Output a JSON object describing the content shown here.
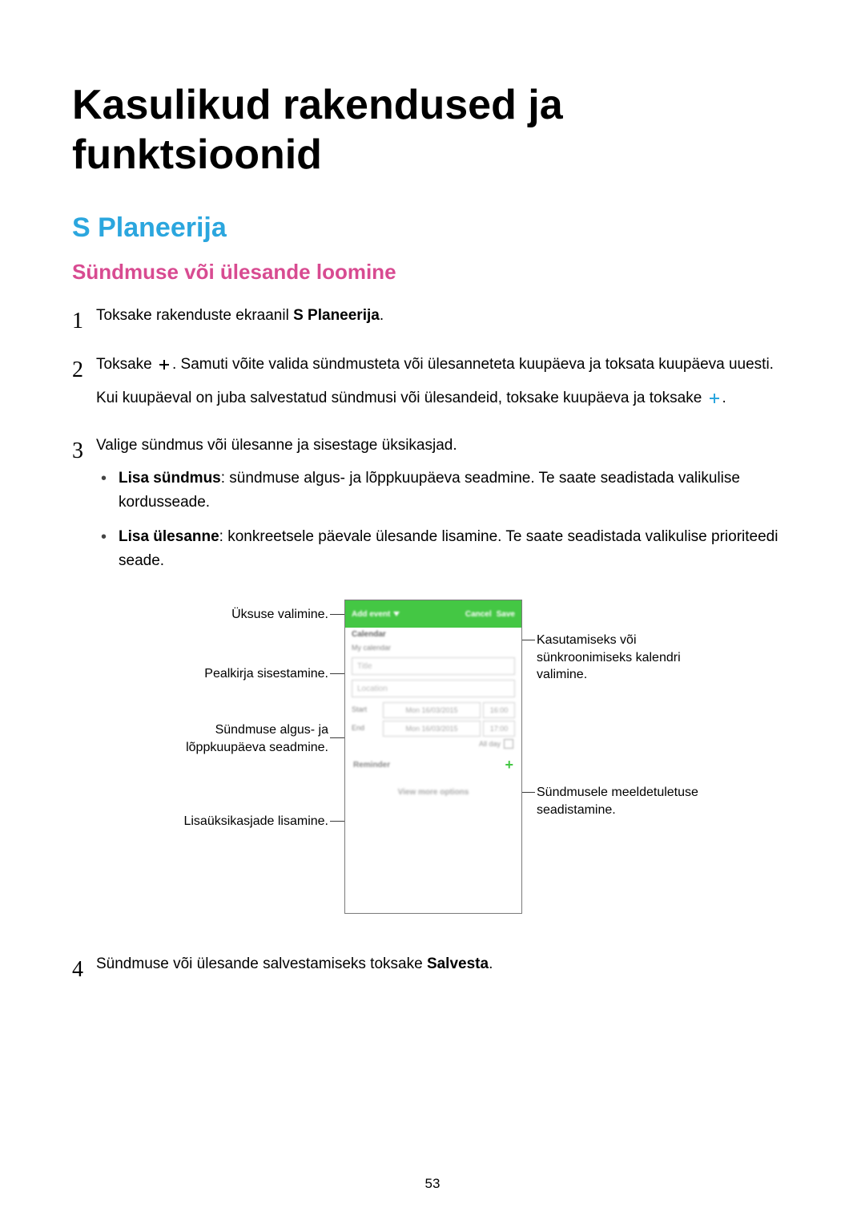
{
  "title": "Kasulikud rakendused ja funktsioonid",
  "section": "S Planeerija",
  "subsection": "Sündmuse või ülesande loomine",
  "steps": {
    "s1": {
      "num": "1",
      "part1": "Toksake rakenduste ekraanil ",
      "bold": "S Planeerija",
      "part2": "."
    },
    "s2": {
      "num": "2",
      "p1a": "Toksake ",
      "p1b": ". Samuti võite valida sündmusteta või ülesanneteta kuupäeva ja toksata kuupäeva uuesti.",
      "p2a": "Kui kuupäeval on juba salvestatud sündmusi või ülesandeid, toksake kuupäeva ja toksake ",
      "p2b": "."
    },
    "s3": {
      "num": "3",
      "intro": "Valige sündmus või ülesanne ja sisestage üksikasjad.",
      "li1_bold": "Lisa sündmus",
      "li1_rest": ": sündmuse algus- ja lõppkuupäeva seadmine. Te saate seadistada valikulise kordusseade.",
      "li2_bold": "Lisa ülesanne",
      "li2_rest": ": konkreetsele päevale ülesande lisamine. Te saate seadistada valikulise prioriteedi seade."
    },
    "s4": {
      "num": "4",
      "part1": "Sündmuse või ülesande salvestamiseks toksake ",
      "bold": "Salvesta",
      "part2": "."
    }
  },
  "callouts": {
    "c1": "Üksuse valimine.",
    "c2": "Pealkirja sisestamine.",
    "c3": "Sündmuse algus- ja lõppkuupäeva seadmine.",
    "c4": "Lisaüksikasjade lisamine.",
    "r1": "Kasutamiseks või sünkroonimiseks kalendri valimine.",
    "r2": "Sündmusele meeldetuletuse seadistamine."
  },
  "phone": {
    "addEvent": "Add event",
    "cancel": "Cancel",
    "save": "Save",
    "calendar": "Calendar",
    "myCalendar": "My calendar",
    "title": "Title",
    "location": "Location",
    "start": "Start",
    "end": "End",
    "date": "Mon 16/03/2015",
    "t1": "16:00",
    "t2": "17:00",
    "allDay": "All day",
    "reminder": "Reminder",
    "viewMore": "View more options"
  },
  "pageNumber": "53"
}
